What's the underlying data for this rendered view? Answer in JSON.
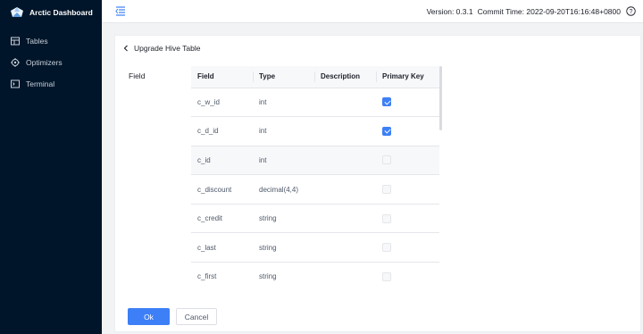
{
  "app": {
    "title": "Arctic Dashboard"
  },
  "sidebar": {
    "items": [
      {
        "label": "Tables",
        "icon": "table-icon"
      },
      {
        "label": "Optimizers",
        "icon": "optimizer-icon"
      },
      {
        "label": "Terminal",
        "icon": "terminal-icon"
      }
    ]
  },
  "header": {
    "version": "Version: 0.3.1",
    "commit_time": "Commit Time: 2022-09-20T16:16:48+0800"
  },
  "page": {
    "title": "Upgrade Hive Table",
    "field_label": "Field"
  },
  "table": {
    "columns": [
      "Field",
      "Type",
      "Description",
      "Primary Key"
    ],
    "rows": [
      {
        "field": "c_w_id",
        "type": "int",
        "description": "",
        "primary_key": true,
        "disabled": false
      },
      {
        "field": "c_d_id",
        "type": "int",
        "description": "",
        "primary_key": true,
        "disabled": false
      },
      {
        "field": "c_id",
        "type": "int",
        "description": "",
        "primary_key": false,
        "disabled": true
      },
      {
        "field": "c_discount",
        "type": "decimal(4,4)",
        "description": "",
        "primary_key": false,
        "disabled": true
      },
      {
        "field": "c_credit",
        "type": "string",
        "description": "",
        "primary_key": false,
        "disabled": true
      },
      {
        "field": "c_last",
        "type": "string",
        "description": "",
        "primary_key": false,
        "disabled": true
      },
      {
        "field": "c_first",
        "type": "string",
        "description": "",
        "primary_key": false,
        "disabled": true
      }
    ]
  },
  "buttons": {
    "ok": "Ok",
    "cancel": "Cancel"
  },
  "colors": {
    "sidebar_bg": "#001529",
    "primary": "#3d7ff6"
  }
}
